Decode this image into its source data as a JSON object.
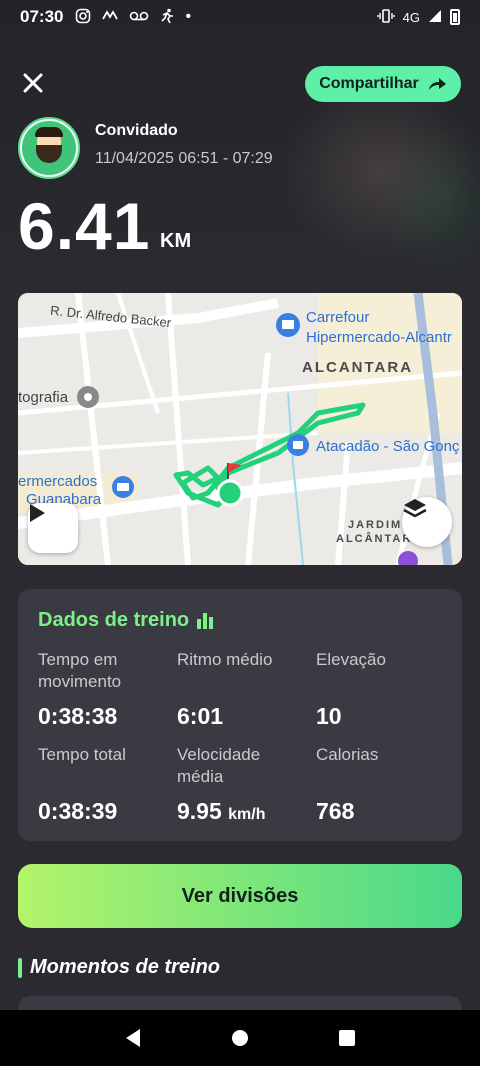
{
  "status_bar": {
    "time": "07:30",
    "network": "4G"
  },
  "header": {
    "share_label": "Compartilhar",
    "user_name": "Convidado",
    "date_range": "11/04/2025 06:51 - 07:29",
    "distance_value": "6.41",
    "distance_unit": "KM"
  },
  "map": {
    "labels": {
      "street": "R. Dr. Alfredo Backer",
      "carrefour_line1": "Carrefour",
      "carrefour_line2": "Hipermercado-Alcantr",
      "district": "ALCANTARA",
      "photo": "tografia",
      "atacadao": "Atacadão - São Gonç",
      "guanabara_line1": "ermercados",
      "guanabara_line2": "Guanabara",
      "jardim_line1": "JARDIM",
      "jardim_line2": "ALCÂNTARA"
    },
    "route_color": "#22d17a"
  },
  "stats": {
    "title": "Dados de treino",
    "items": [
      {
        "label": "Tempo em movimento",
        "value": "0:38:38",
        "unit": ""
      },
      {
        "label": "Ritmo médio",
        "value": "6:01",
        "unit": ""
      },
      {
        "label": "Elevação",
        "value": "10",
        "unit": ""
      },
      {
        "label": "Tempo total",
        "value": "0:38:39",
        "unit": ""
      },
      {
        "label": "Velocidade média",
        "value": "9.95",
        "unit": "km/h"
      },
      {
        "label": "Calorias",
        "value": "768",
        "unit": ""
      }
    ]
  },
  "divisions_button": "Ver divisões",
  "moments_title": "Momentos de treino",
  "colors": {
    "accent_green": "#7ef08a",
    "share_button": "#5ef0a8",
    "background": "#2a2a30",
    "card": "#3a3a42"
  }
}
